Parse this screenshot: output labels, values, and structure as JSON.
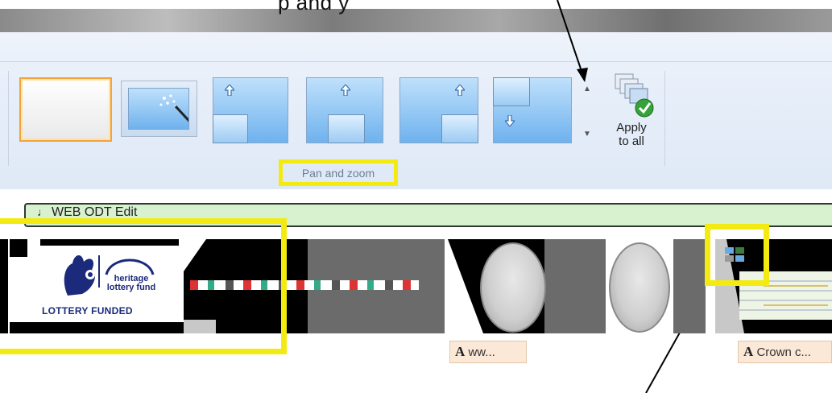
{
  "top_caption": "p  and        y",
  "ribbon": {
    "group_label": "Pan and zoom",
    "apply_button": {
      "line1": "Apply",
      "line2": "to all"
    },
    "gallery": {
      "items": [
        "no-pan-zoom",
        "automatic",
        "pan-up-left",
        "pan-up-center",
        "pan-up-right",
        "pan-down-left"
      ],
      "scroll_up": "▲",
      "scroll_down": "▼"
    }
  },
  "timeline": {
    "audio_track_label": "WEB ODT Edit",
    "lottery_logo": {
      "line1": "heritage",
      "line2": "lottery fund",
      "line3": "LOTTERY FUNDED"
    },
    "captions": [
      {
        "text": "ww..."
      },
      {
        "text": "Crown c..."
      }
    ],
    "caption_icon": "A"
  },
  "colors": {
    "highlight": "#f3ea12",
    "selected_border": "#f2a33a",
    "ribbon_bg": "#e6eef9",
    "audio_track": "#d8f1cf"
  }
}
